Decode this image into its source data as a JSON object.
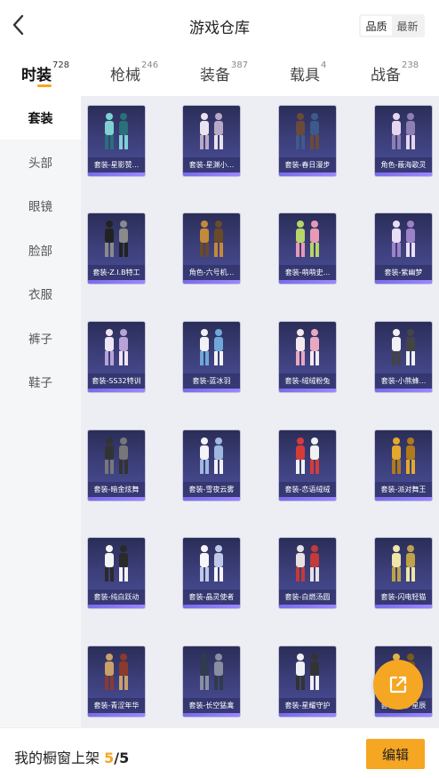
{
  "header": {
    "title": "游戏仓库",
    "sort_options": [
      "品质",
      "最新"
    ]
  },
  "tabs": [
    {
      "label": "时装",
      "count": "728"
    },
    {
      "label": "枪械",
      "count": "246"
    },
    {
      "label": "装备",
      "count": "387"
    },
    {
      "label": "载具",
      "count": "4"
    },
    {
      "label": "战备",
      "count": "238"
    }
  ],
  "sidebar": {
    "items": [
      "套装",
      "头部",
      "眼镜",
      "脸部",
      "衣服",
      "裤子",
      "鞋子"
    ]
  },
  "items": [
    "套装-星影赞...",
    "套装-星渊小...",
    "套装-春日漫步",
    "角色-蔽海歌灵",
    "套装-Z.I.B特工",
    "角色-六号机...",
    "套装-萌萌史...",
    "套装-紫幽梦",
    "套装-SS32特训",
    "套装-蓝冰羽",
    "套装-绒绒粉兔",
    "套装-小熊蜂...",
    "套装-暗金炫舞",
    "套装-雪夜云雾",
    "套装-恋语绒绒",
    "套装-派对舞王",
    "套装-纯白跃动",
    "套装-晶灵使者",
    "套装-白燃汤圆",
    "套装-闪电轻猫",
    "套装-青涩年华",
    "套装-长空猛禽",
    "套装-星耀守护",
    "套装-绮梦星辰"
  ],
  "bottom": {
    "showcase_label": "我的橱窗上架",
    "current": "5",
    "separator": "/",
    "total": "5",
    "edit_label": "编辑"
  },
  "colors": {
    "accent": "#f5a623",
    "card_bg": "#3b3e78",
    "grid_bg": "#eceef4"
  }
}
